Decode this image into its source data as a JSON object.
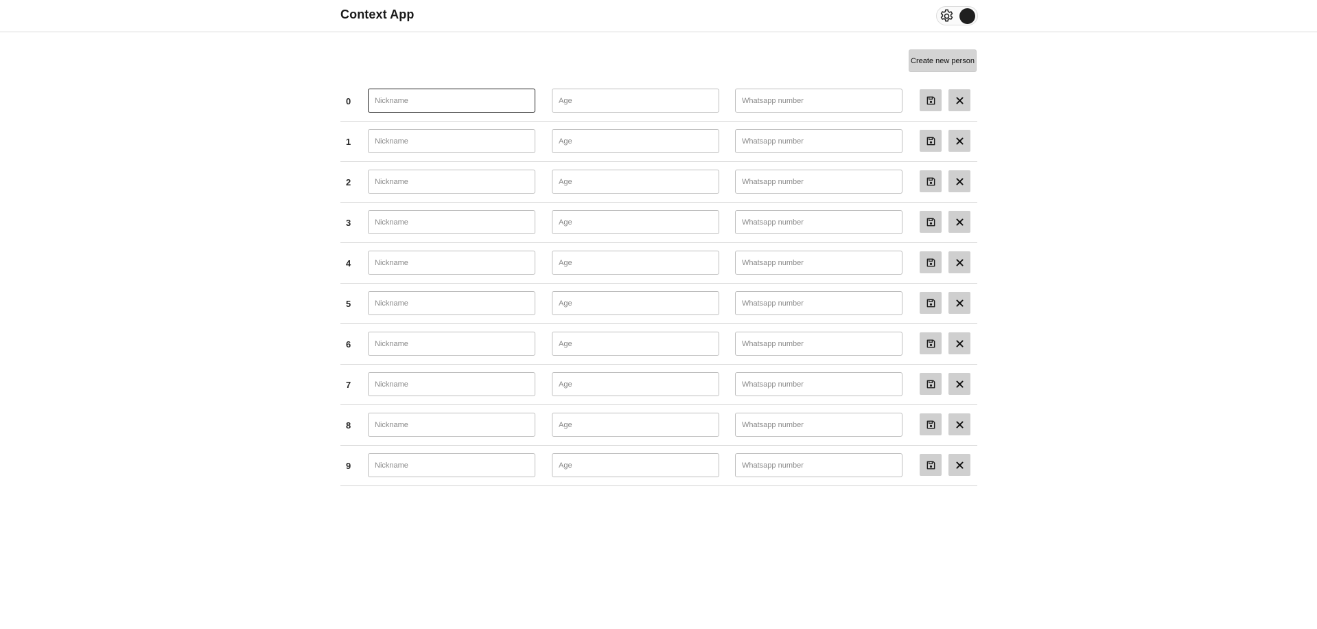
{
  "header": {
    "title": "Context App",
    "theme_toggle": {
      "gear_icon": "gear-icon",
      "state": "dark"
    }
  },
  "toolbar": {
    "create_label": "Create new person"
  },
  "fields": {
    "nickname_placeholder": "Nickname",
    "age_placeholder": "Age",
    "whatsapp_placeholder": "Whatsapp number"
  },
  "icons": {
    "save": "floppy-disk-icon",
    "delete": "close-icon"
  },
  "rows": [
    {
      "index": "0",
      "nickname": "",
      "age": "",
      "whatsapp": "",
      "focused": true
    },
    {
      "index": "1",
      "nickname": "",
      "age": "",
      "whatsapp": "",
      "focused": false
    },
    {
      "index": "2",
      "nickname": "",
      "age": "",
      "whatsapp": "",
      "focused": false
    },
    {
      "index": "3",
      "nickname": "",
      "age": "",
      "whatsapp": "",
      "focused": false
    },
    {
      "index": "4",
      "nickname": "",
      "age": "",
      "whatsapp": "",
      "focused": false
    },
    {
      "index": "5",
      "nickname": "",
      "age": "",
      "whatsapp": "",
      "focused": false
    },
    {
      "index": "6",
      "nickname": "",
      "age": "",
      "whatsapp": "",
      "focused": false
    },
    {
      "index": "7",
      "nickname": "",
      "age": "",
      "whatsapp": "",
      "focused": false
    },
    {
      "index": "8",
      "nickname": "",
      "age": "",
      "whatsapp": "",
      "focused": false
    },
    {
      "index": "9",
      "nickname": "",
      "age": "",
      "whatsapp": "",
      "focused": false
    }
  ],
  "colors": {
    "button_bg": "#cfcfcf",
    "divider": "#d4d4d4",
    "toggle_knob": "#1f1f1f"
  }
}
